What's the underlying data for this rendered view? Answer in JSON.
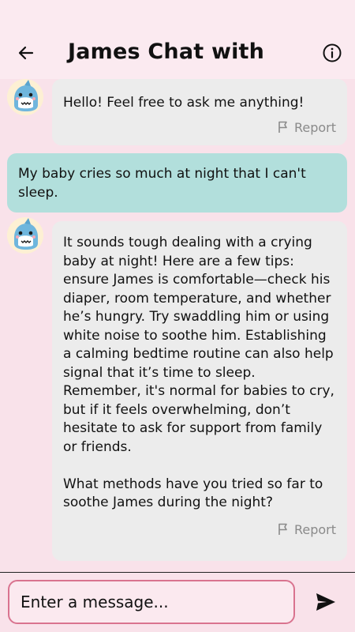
{
  "header": {
    "title": "James Chat with",
    "back_icon": "arrow-left-icon",
    "info_icon": "info-circle-icon"
  },
  "messages": [
    {
      "role": "bot",
      "text": "Hello! Feel free to ask me anything!",
      "report_label": "Report"
    },
    {
      "role": "user",
      "text": "My baby cries so much at night that I can't sleep."
    },
    {
      "role": "bot",
      "text": "It sounds tough dealing with a crying baby at night! Here are a few tips: ensure James is comfortable—check his diaper, room temperature, and whether he’s hungry. Try swaddling him or using white noise to soothe him. Establishing a calming bedtime routine can also help signal that it’s time to sleep. Remember, it's normal for babies to cry, but if it feels overwhelming, don’t hesitate to ask for support from family or friends.\n\nWhat methods have you tried so far to soothe James during the night?",
      "report_label": "Report"
    }
  ],
  "composer": {
    "placeholder": "Enter a message...",
    "send_icon": "send-icon"
  },
  "colors": {
    "background": "#f9e2ea",
    "bot_bubble": "#ececec",
    "user_bubble": "#b2dfdc",
    "input_border": "#d9738f"
  }
}
